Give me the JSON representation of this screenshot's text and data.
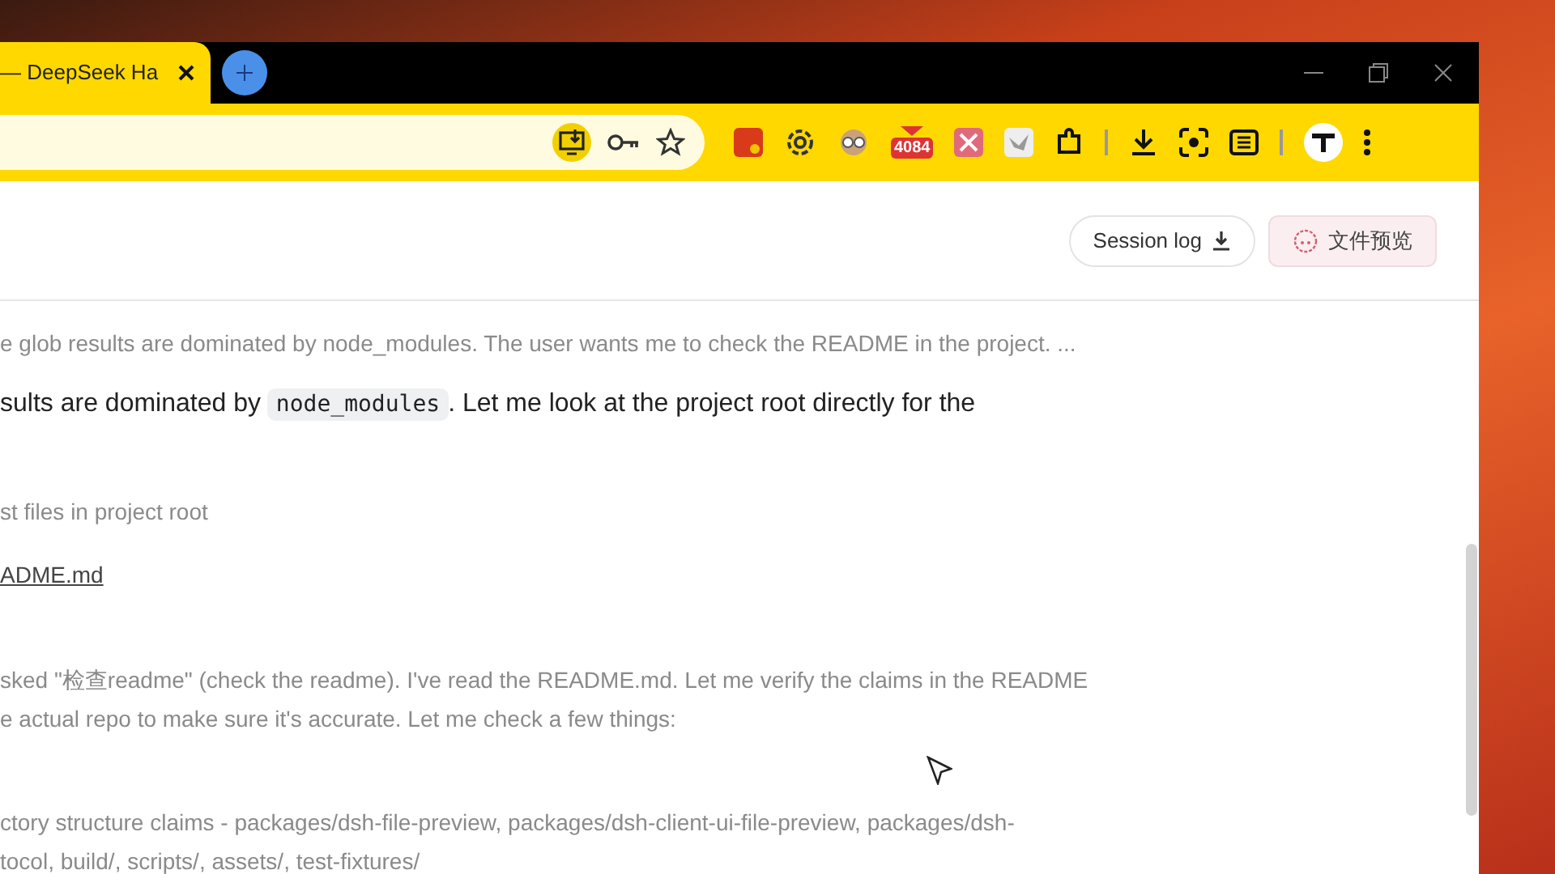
{
  "browser": {
    "tab": {
      "title": "— DeepSeek Ha",
      "selected": true
    },
    "extension_badge": "4084"
  },
  "header": {
    "buttons": [
      {
        "label": "Session log",
        "kind": "download"
      },
      {
        "label": "文件预览",
        "kind": "preview"
      }
    ]
  },
  "transcript": [
    {
      "kind": "thinking",
      "lines": [
        "e glob results are dominated by node_modules. The user wants me to check the README in the project. ..."
      ]
    },
    {
      "kind": "message",
      "parts": [
        {
          "kind": "text",
          "text": "sults are dominated by "
        },
        {
          "kind": "code",
          "text": "node_modules"
        },
        {
          "kind": "text",
          "text": ". Let me look at the project root directly for the"
        }
      ]
    },
    {
      "kind": "tool",
      "text": "st files in project root"
    },
    {
      "kind": "file",
      "text": "ADME.md"
    },
    {
      "kind": "thinking",
      "lines": [
        "sked \"检查readme\" (check the readme). I've read the README.md. Let me verify the claims in the README",
        "e actual repo to make sure it's accurate. Let me check a few things:"
      ]
    },
    {
      "kind": "thinking",
      "lines": [
        "ctory structure claims - packages/dsh-file-preview, packages/dsh-client-ui-file-preview, packages/dsh-",
        "tocol, build/, scripts/, assets/, test-fixtures/"
      ]
    }
  ]
}
